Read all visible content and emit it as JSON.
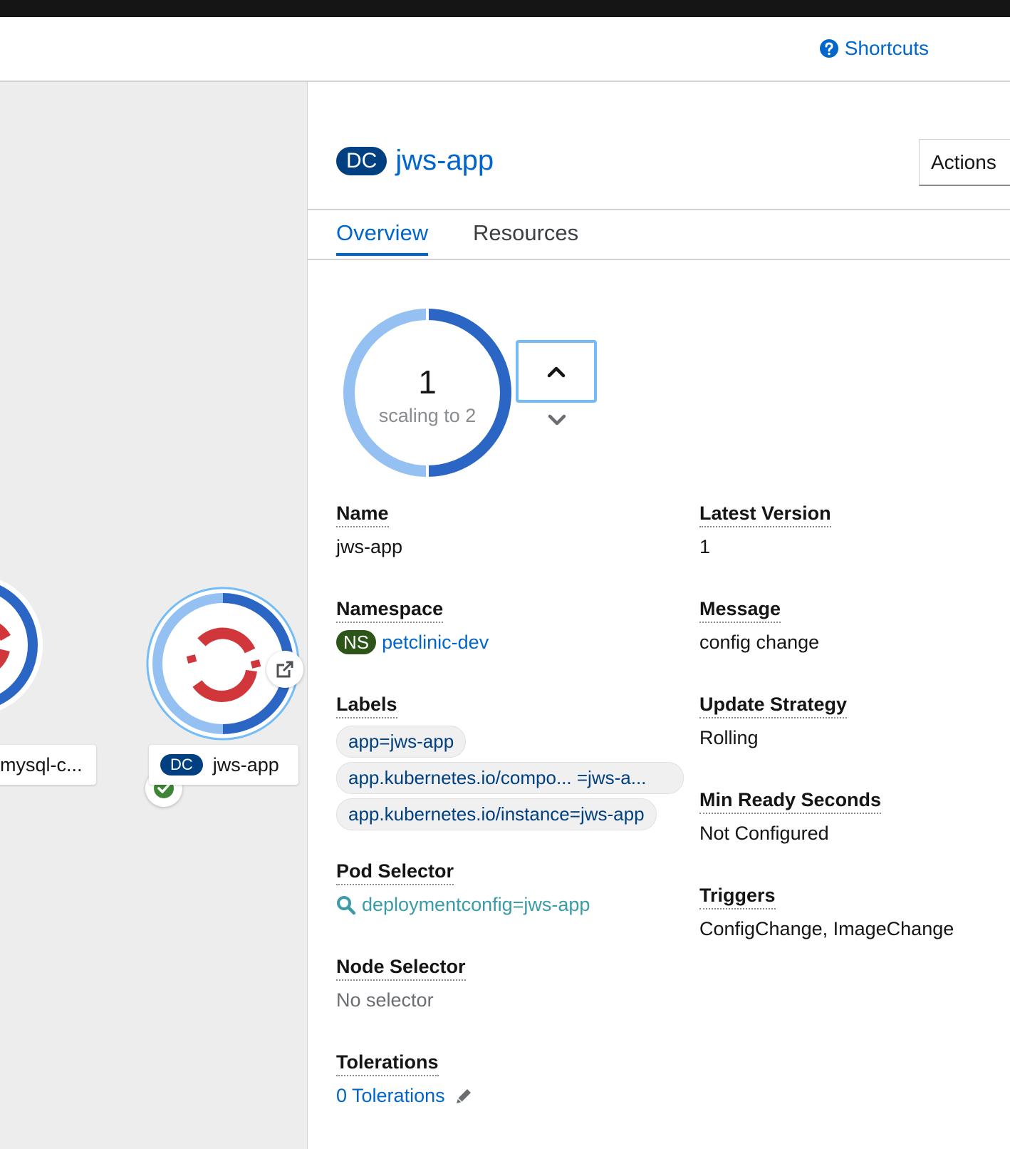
{
  "toolbar": {
    "shortcuts_label": "Shortcuts"
  },
  "canvas": {
    "nodes": [
      {
        "badge": "",
        "label": "mysql-c..."
      },
      {
        "badge": "DC",
        "label": "jws-app"
      }
    ]
  },
  "panel": {
    "badge": "DC",
    "title": "jws-app",
    "actions_label": "Actions",
    "tabs": [
      {
        "label": "Overview"
      },
      {
        "label": "Resources"
      }
    ],
    "pods": {
      "count": "1",
      "status": "scaling to 2"
    },
    "fields": {
      "name": {
        "term": "Name",
        "value": "jws-app"
      },
      "namespace": {
        "term": "Namespace",
        "badge": "NS",
        "value": "petclinic-dev"
      },
      "labels": {
        "term": "Labels",
        "items": [
          "app=jws-app",
          "app.kubernetes.io/compo...  =jws-a...",
          "app.kubernetes.io/instance=jws-app"
        ]
      },
      "pod_selector": {
        "term": "Pod Selector",
        "value": "deploymentconfig=jws-app"
      },
      "node_selector": {
        "term": "Node Selector",
        "value": "No selector"
      },
      "tolerations": {
        "term": "Tolerations",
        "value": "0 Tolerations"
      },
      "latest_version": {
        "term": "Latest Version",
        "value": "1"
      },
      "message": {
        "term": "Message",
        "value": "config change"
      },
      "update_strategy": {
        "term": "Update Strategy",
        "value": "Rolling"
      },
      "min_ready_seconds": {
        "term": "Min Ready Seconds",
        "value": "Not Configured"
      },
      "triggers": {
        "term": "Triggers",
        "value": "ConfigChange, ImageChange"
      }
    }
  },
  "colors": {
    "link": "#0066cc",
    "pod_running": "#2b66c5",
    "pod_pending": "#94c1f2",
    "openshift_red": "#d0363a",
    "namespace_badge": "#2d5519",
    "selector_link": "#3a9ca6"
  }
}
